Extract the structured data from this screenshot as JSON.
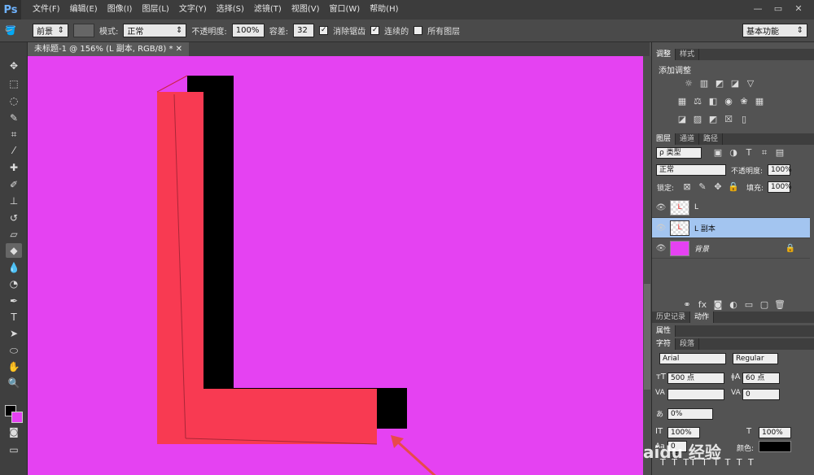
{
  "app": {
    "logo": "Ps",
    "menu": [
      "文件(F)",
      "编辑(E)",
      "图像(I)",
      "图层(L)",
      "文字(Y)",
      "选择(S)",
      "滤镜(T)",
      "视图(V)",
      "窗口(W)",
      "帮助(H)"
    ]
  },
  "options": {
    "fill_source": "前景",
    "mode_label": "模式:",
    "mode": "正常",
    "opacity_label": "不透明度:",
    "opacity": "100%",
    "tolerance_label": "容差:",
    "tolerance": "32",
    "antialias": "消除锯齿",
    "contiguous": "连续的",
    "all_layers": "所有图层",
    "workspace": "基本功能"
  },
  "document": {
    "tab": "未标题-1 @ 156% (L 副本, RGB/8) *",
    "canvas_color": "#e542f2",
    "shape_color": "#f83a52",
    "shadow_color": "#000000"
  },
  "adjust": {
    "tabs": [
      "调整",
      "样式"
    ],
    "title": "添加调整"
  },
  "layers": {
    "tabs": [
      "图层",
      "通道",
      "路径"
    ],
    "filter": "ρ 类型",
    "blend": "正常",
    "opacity_label": "不透明度:",
    "opacity": "100%",
    "lock_label": "锁定:",
    "fill_label": "填充:",
    "fill": "100%",
    "items": [
      {
        "name": "L",
        "thumb": "L"
      },
      {
        "name": "L 副本",
        "thumb": "L"
      },
      {
        "name": "背景",
        "thumb": ""
      }
    ]
  },
  "history": {
    "tabs": [
      "历史记录",
      "动作"
    ]
  },
  "properties": {
    "title": "属性"
  },
  "character": {
    "tabs": [
      "字符",
      "段落"
    ],
    "font": "Arial",
    "style": "Regular",
    "size": "500 点",
    "leading": "60 点",
    "tracking": "0",
    "scale_v": "0%",
    "scale_h": "100%",
    "scale_h2": "100%",
    "color_label": "颜色:",
    "baseline": "0 点"
  },
  "watermark": "aidu 经验"
}
